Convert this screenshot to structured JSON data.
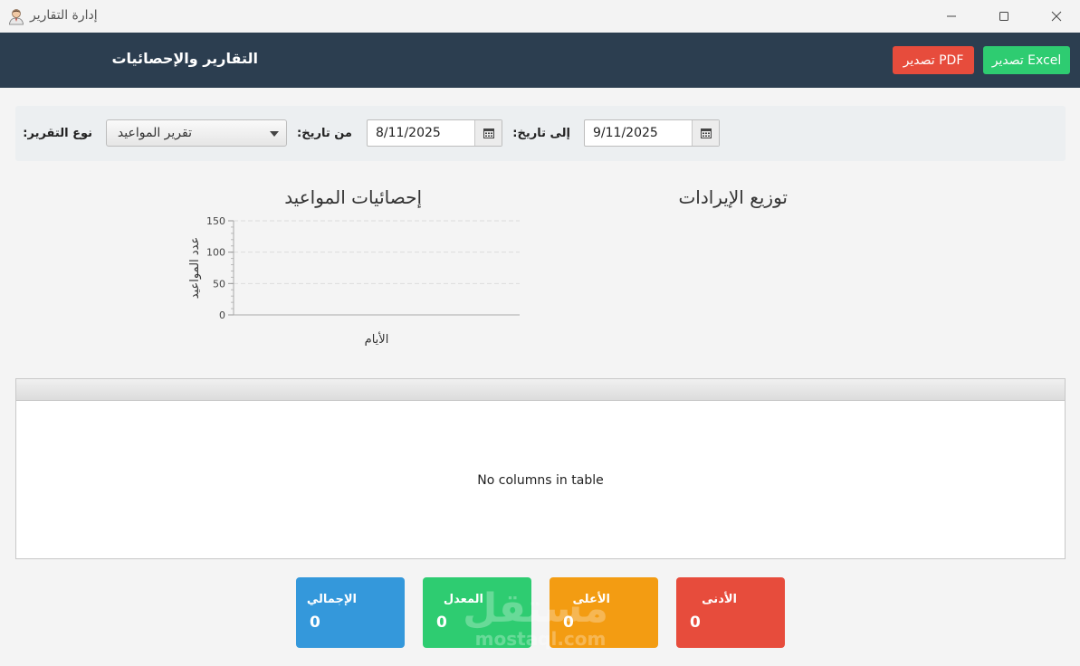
{
  "window": {
    "title": "إدارة التقارير",
    "icon": "user-avatar-icon"
  },
  "header": {
    "title": "التقارير والإحصائيات",
    "export_excel_label": "تصدير Excel",
    "export_pdf_label": "تصدير PDF"
  },
  "filters": {
    "to_date_label": "إلى تاريخ:",
    "to_date_value": "9/11/2025",
    "from_date_label": "من تاريخ:",
    "from_date_value": "8/11/2025",
    "report_type_label": "نوع التقرير:",
    "report_type_value": "تقرير المواعيد"
  },
  "charts": {
    "revenue_title": "توزيع الإيرادات",
    "appointments_title": "إحصائيات المواعيد"
  },
  "chart_data": {
    "type": "bar",
    "title": "إحصائيات المواعيد",
    "xlabel": "الأيام",
    "ylabel": "عدد المواعيد",
    "categories": [],
    "values": [],
    "ylim": [
      0,
      150
    ],
    "yticks": [
      0,
      50,
      100,
      150
    ],
    "grid": true
  },
  "table": {
    "placeholder": "No columns in table"
  },
  "stats": {
    "total": {
      "label": "الإجمالي",
      "value": "0"
    },
    "average": {
      "label": "المعدل",
      "value": "0"
    },
    "maximum": {
      "label": "الأعلى",
      "value": "0"
    },
    "minimum": {
      "label": "الأدنى",
      "value": "0"
    }
  },
  "watermark": {
    "main": "مستقل",
    "sub": "mostaql.com"
  },
  "colors": {
    "header_bg": "#2c3e50",
    "excel_green": "#2ecc71",
    "pdf_red": "#e74c3c",
    "total_blue": "#3498db",
    "average_green": "#2ecc71",
    "maximum_orange": "#f39c12",
    "minimum_red": "#e74c3c"
  }
}
